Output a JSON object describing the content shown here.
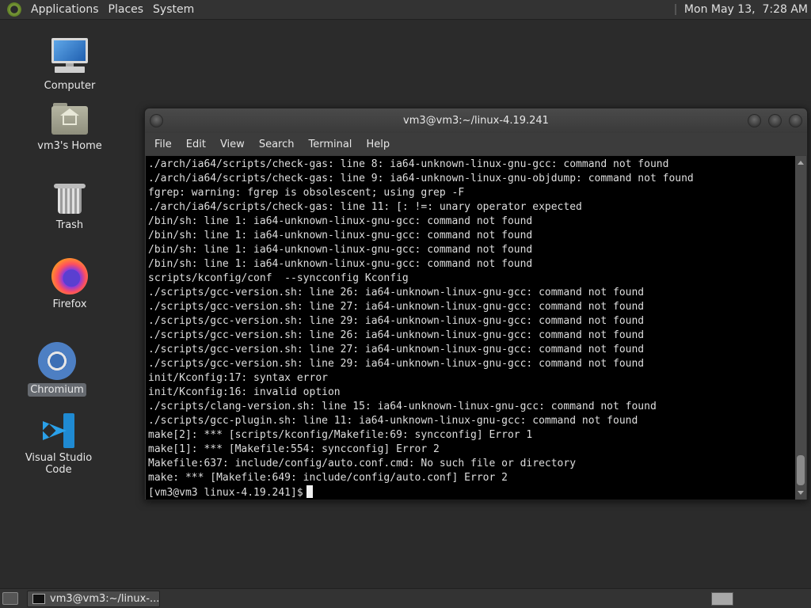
{
  "top_panel": {
    "menus": [
      "Applications",
      "Places",
      "System"
    ],
    "clock": "Mon May 13,  7:28 AM"
  },
  "desktop_icons": [
    {
      "label": "Computer",
      "icon": "computer-icon"
    },
    {
      "label": "vm3's Home",
      "icon": "home-folder-icon"
    },
    {
      "label": "Trash",
      "icon": "trash-icon"
    },
    {
      "label": "Firefox",
      "icon": "firefox-icon"
    },
    {
      "label": "Chromium",
      "icon": "chromium-icon",
      "selected": true
    },
    {
      "label": "Visual Studio Code",
      "icon": "vscode-icon"
    }
  ],
  "terminal": {
    "title": "vm3@vm3:~/linux-4.19.241",
    "menu": [
      "File",
      "Edit",
      "View",
      "Search",
      "Terminal",
      "Help"
    ],
    "lines": [
      "./arch/ia64/scripts/check-gas: line 8: ia64-unknown-linux-gnu-gcc: command not found",
      "./arch/ia64/scripts/check-gas: line 9: ia64-unknown-linux-gnu-objdump: command not found",
      "fgrep: warning: fgrep is obsolescent; using grep -F",
      "./arch/ia64/scripts/check-gas: line 11: [: !=: unary operator expected",
      "/bin/sh: line 1: ia64-unknown-linux-gnu-gcc: command not found",
      "/bin/sh: line 1: ia64-unknown-linux-gnu-gcc: command not found",
      "/bin/sh: line 1: ia64-unknown-linux-gnu-gcc: command not found",
      "/bin/sh: line 1: ia64-unknown-linux-gnu-gcc: command not found",
      "scripts/kconfig/conf  --syncconfig Kconfig",
      "./scripts/gcc-version.sh: line 26: ia64-unknown-linux-gnu-gcc: command not found",
      "./scripts/gcc-version.sh: line 27: ia64-unknown-linux-gnu-gcc: command not found",
      "./scripts/gcc-version.sh: line 29: ia64-unknown-linux-gnu-gcc: command not found",
      "./scripts/gcc-version.sh: line 26: ia64-unknown-linux-gnu-gcc: command not found",
      "./scripts/gcc-version.sh: line 27: ia64-unknown-linux-gnu-gcc: command not found",
      "./scripts/gcc-version.sh: line 29: ia64-unknown-linux-gnu-gcc: command not found",
      "init/Kconfig:17: syntax error",
      "init/Kconfig:16: invalid option",
      "./scripts/clang-version.sh: line 15: ia64-unknown-linux-gnu-gcc: command not found",
      "./scripts/gcc-plugin.sh: line 11: ia64-unknown-linux-gnu-gcc: command not found",
      "make[2]: *** [scripts/kconfig/Makefile:69: syncconfig] Error 1",
      "make[1]: *** [Makefile:554: syncconfig] Error 2",
      "Makefile:637: include/config/auto.conf.cmd: No such file or directory",
      "make: *** [Makefile:649: include/config/auto.conf] Error 2"
    ],
    "prompt": "[vm3@vm3 linux-4.19.241]$"
  },
  "taskbar": {
    "task_label": "vm3@vm3:~/linux-..."
  }
}
